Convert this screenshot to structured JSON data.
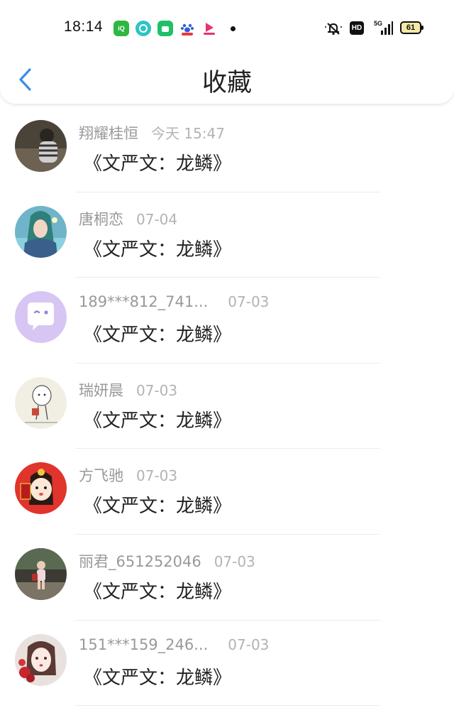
{
  "status_bar": {
    "time": "18:14",
    "network": "5G",
    "hd_label": "HD",
    "battery": "61",
    "apps": [
      "iqiyi-icon",
      "chat-app-icon",
      "shop-app-icon",
      "baidu-icon",
      "video-app-icon"
    ]
  },
  "header": {
    "title": "收藏",
    "back_icon": "chevron-left-icon",
    "accent_color": "#3a8ee6"
  },
  "items": [
    {
      "sender": "翔耀桂恒",
      "date": "今天 15:47",
      "message": "《文严文：龙鳞》"
    },
    {
      "sender": "唐桐恋",
      "date": "07-04",
      "message": "《文严文：龙鳞》"
    },
    {
      "sender": "189***812_741...",
      "date": "07-03",
      "message": "《文严文：龙鳞》"
    },
    {
      "sender": "瑞妍晨",
      "date": "07-03",
      "message": "《文严文：龙鳞》"
    },
    {
      "sender": "方飞驰",
      "date": "07-03",
      "message": "《文严文：龙鳞》"
    },
    {
      "sender": "丽君_651252046",
      "date": "07-03",
      "message": "《文严文：龙鳞》"
    },
    {
      "sender": "151***159_246...",
      "date": "07-03",
      "message": "《文严文：龙鳞》"
    }
  ]
}
